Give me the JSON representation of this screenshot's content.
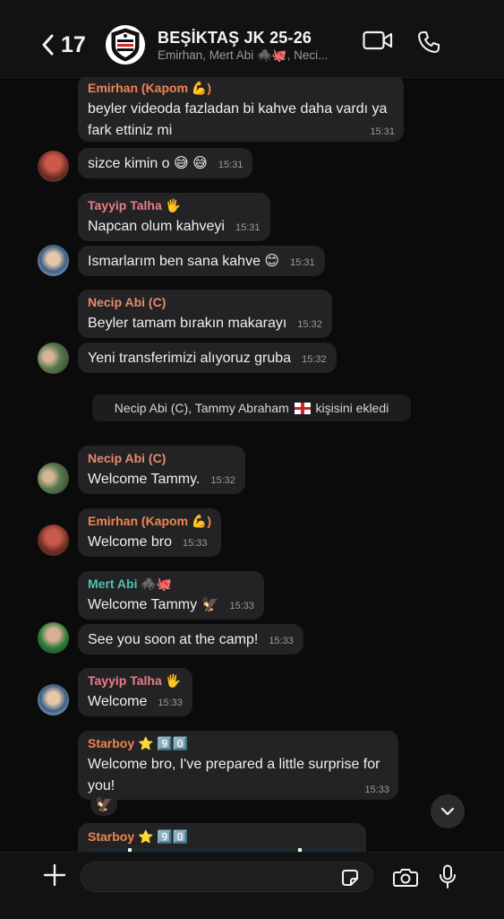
{
  "header": {
    "back_count": "17",
    "group_name": "BEŞİKTAŞ JK 25-26",
    "members_preview": "Emirhan, Mert Abi 🕷️🐙, Neci..."
  },
  "messages": [
    {
      "sender": "Emirhan (Kapom 💪)",
      "text": "beyler videoda fazladan bi kahve daha vardı ya fark ettiniz mi",
      "time": "15:31"
    },
    {
      "sender": "",
      "text": "sizce kimin o 😅 😅",
      "time": "15:31"
    },
    {
      "sender": "Tayyip Talha 🖐",
      "text": "Napcan olum kahveyi",
      "time": "15:31"
    },
    {
      "sender": "",
      "text": "Ismarlarım ben sana kahve 😊",
      "time": "15:31"
    },
    {
      "sender": "Necip Abi (C)",
      "text": "Beyler tamam bırakın makarayı",
      "time": "15:32"
    },
    {
      "sender": "",
      "text": "Yeni transferimizi alıyoruz gruba",
      "time": "15:32"
    },
    {
      "sender": "Necip Abi (C)",
      "text": "Welcome Tammy.",
      "time": "15:32"
    },
    {
      "sender": "Emirhan (Kapom 💪)",
      "text": "Welcome bro",
      "time": "15:33"
    },
    {
      "sender": "Mert Abi 🕷️🐙",
      "text": "Welcome Tammy 🦅",
      "time": "15:33"
    },
    {
      "sender": "",
      "text": "See you soon at the camp!",
      "time": "15:33"
    },
    {
      "sender": "Tayyip Talha 🖐",
      "text": "Welcome",
      "time": "15:33"
    },
    {
      "sender": "Starboy ⭐ 9️⃣0️⃣",
      "text": "Welcome bro, I've prepared a little surprise for you!",
      "time": "15:33"
    }
  ],
  "system_message": {
    "text_before_flag": "Necip Abi (C), Tammy Abraham",
    "text_after_flag": "kişisini ekledi"
  },
  "reaction": "🦅",
  "next_message": {
    "sender": "Starboy ⭐ 9️⃣0️⃣"
  },
  "input": {
    "placeholder": "",
    "value": ""
  },
  "icons": {
    "back": "chevron-left-icon",
    "video": "video-camera-icon",
    "call": "phone-icon",
    "plus": "plus-icon",
    "sticker": "sticker-icon",
    "camera": "camera-icon",
    "mic": "microphone-icon",
    "scroll": "chevron-down-icon"
  },
  "colors": {
    "background": "#0b0b0b",
    "bubble": "#232325",
    "sender_orange": "#f08550",
    "sender_pink": "#ec7d87",
    "sender_teal": "#4fc1b0",
    "sender_salmon": "#e58a70"
  }
}
